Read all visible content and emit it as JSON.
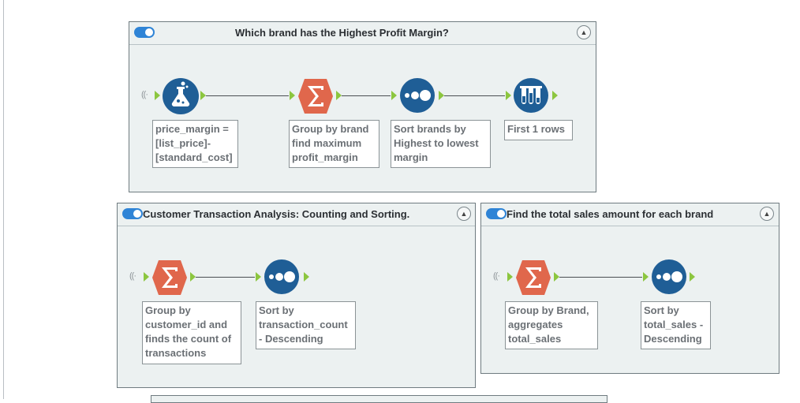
{
  "containers": [
    {
      "title": "Which brand has the Highest Profit Margin?",
      "notes": [
        "price_margin =\n[list_price]-\n[standard_cost]",
        "Group by brand\nfind maximum\nprofit_margin",
        "Sort  brands by\nHighest to lowest\nmargin",
        "First 1 rows"
      ]
    },
    {
      "title": "Customer Transaction Analysis: Counting and Sorting.",
      "notes": [
        "Group by\ncustomer_id  and\nfinds the count of\ntransactions",
        "Sort by\ntransaction_count\n- Descending"
      ]
    },
    {
      "title": "Find the total sales amount for each brand",
      "notes": [
        "Group by Brand,\naggregates\ntotal_sales",
        "Sort by\ntotal_sales -\nDescending"
      ]
    }
  ],
  "icons": {
    "formula": "formula-tool-icon",
    "summarize": "summarize-tool-icon",
    "sort": "sort-tool-icon",
    "sample": "sample-tool-icon"
  },
  "colors": {
    "tool_blue": "#1f5e96",
    "tool_orange": "#e0674c",
    "anchor_green": "#8cc63f",
    "toggle_blue": "#2f84d6",
    "container_bg": "#ecf1f1"
  }
}
